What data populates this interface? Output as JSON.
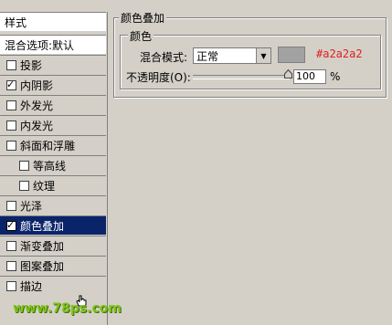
{
  "styles_panel": {
    "header": "样式",
    "blend_options": "混合选项:默认",
    "items": [
      {
        "label": "投影",
        "checked": false
      },
      {
        "label": "内阴影",
        "checked": true
      },
      {
        "label": "外发光",
        "checked": false
      },
      {
        "label": "内发光",
        "checked": false
      },
      {
        "label": "斜面和浮雕",
        "checked": false
      },
      {
        "label": "等高线",
        "checked": false
      },
      {
        "label": "纹理",
        "checked": false
      },
      {
        "label": "光泽",
        "checked": false
      },
      {
        "label": "颜色叠加",
        "checked": true,
        "selected": true
      },
      {
        "label": "渐变叠加",
        "checked": false
      },
      {
        "label": "图案叠加",
        "checked": false
      },
      {
        "label": "描边",
        "checked": false
      }
    ],
    "watermark": "www.78ps.com"
  },
  "color_overlay": {
    "group_title": "颜色叠加",
    "subgroup_title": "颜色",
    "blend_mode_label": "混合模式:",
    "blend_mode_value": "正常",
    "swatch_color": "#a2a2a2",
    "hex_label": "#a2a2a2",
    "opacity_label": "不透明度(O):",
    "opacity_value": "100",
    "opacity_unit": "%"
  },
  "colors": {
    "selection": "#0a246a",
    "hex_text": "#e02020",
    "watermark": "#7fc31c"
  }
}
